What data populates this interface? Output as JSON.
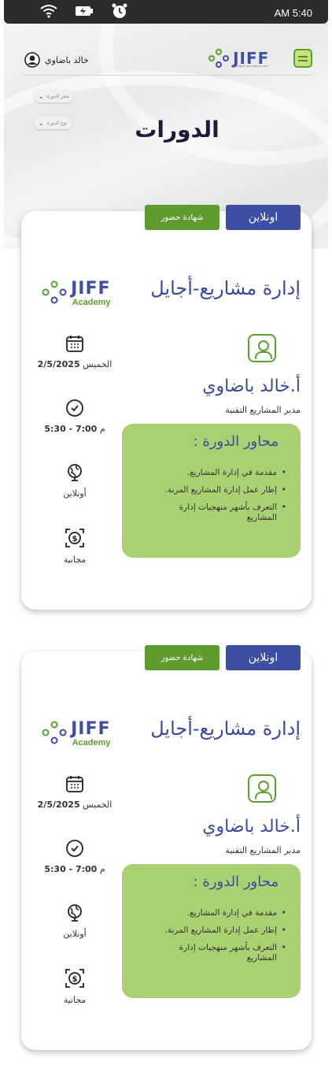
{
  "status_bar": {
    "time": "AM 5:40"
  },
  "header": {
    "user_name": "خالد باضاوي",
    "logo_text": "JIFF",
    "logo_tagline": "WE LAUNCH YOUR APP IN A JIFF",
    "filters": [
      {
        "label": "سعر الدورة"
      },
      {
        "label": "نوع الدورة"
      }
    ],
    "page_title": "الدورات"
  },
  "courses": [
    {
      "badge_online": "اونلاين",
      "badge_cert": "شهادة حضور",
      "title": "إدارة مشاريع-أجايل",
      "academy_logo": "JIFF",
      "academy_sub": "Academy",
      "instructor_name": "أ.خالد باضاوي",
      "instructor_role": "مدير المشاريع التقنية",
      "topics_title": "محاور الدورة :",
      "topics": [
        "مقدمة في إدارة المشاريع.",
        "إطار عمل إدارة المشاريع المرنة.",
        "التعرف بأشهر منهجيات إدارة المشاريع"
      ],
      "date_day": "الخميس",
      "date_value": "2/5/2025",
      "time_range": "5:30 - 7:00",
      "time_unit": "م",
      "mode": "أونلاين",
      "price": "مجانية"
    },
    {
      "badge_online": "اونلاين",
      "badge_cert": "شهادة حضور",
      "title": "إدارة مشاريع-أجايل",
      "academy_logo": "JIFF",
      "academy_sub": "Academy",
      "instructor_name": "أ.خالد باضاوي",
      "instructor_role": "مدير المشاريع التقنية",
      "topics_title": "محاور الدورة :",
      "topics": [
        "مقدمة في إدارة المشاريع.",
        "إطار عمل إدارة المشاريع المرنة.",
        "التعرف بأشهر منهجيات إدارة المشاريع"
      ],
      "date_day": "الخميس",
      "date_value": "2/5/2025",
      "time_range": "5:30 - 7:00",
      "time_unit": "م",
      "mode": "أونلاين",
      "price": "مجانية"
    }
  ],
  "colors": {
    "brand_blue": "#3e4fa3",
    "brand_green": "#5e9c30",
    "topics_bg": "#a9d172"
  }
}
